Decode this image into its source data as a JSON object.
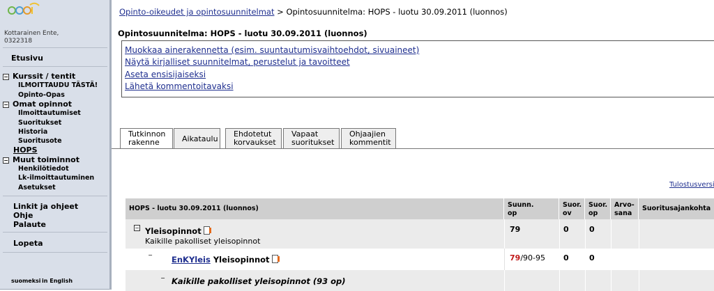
{
  "sidebar": {
    "user_name": "Kottarainen Ente,",
    "user_id": "0322318",
    "home": "Etusivu",
    "sections": [
      {
        "label": "Kurssit / tentit",
        "items": [
          "ILMOITTAUDU TÄSTÄ!",
          "Opinto-Opas"
        ]
      },
      {
        "label": "Omat opinnot",
        "items": [
          "Ilmoittautumiset",
          "Suoritukset",
          "Historia",
          "Suoritusote"
        ]
      },
      {
        "label": "Muut toiminnot",
        "items": [
          "Henkilötiedot",
          "Lk-ilmoittautuminen",
          "Asetukset"
        ]
      }
    ],
    "hops": "HOPS",
    "links": [
      "Linkit ja ohjeet",
      "Ohje",
      "Palaute"
    ],
    "logout": "Lopeta",
    "lang_fi": "suomeksi",
    "lang_en": "in English"
  },
  "breadcrumb": {
    "link": "Opinto-oikeudet ja opintosuunnitelmat",
    "separator": ">",
    "current": "Opintosuunnitelma: HOPS - luotu 30.09.2011 (luonnos)"
  },
  "page_title": "Opintosuunnitelma: HOPS - luotu 30.09.2011 (luonnos)",
  "actions": [
    "Muokkaa ainerakennetta (esim. suuntautumisvaihtoehdot, sivuaineet)",
    "Näytä kirjalliset suunnitelmat, perustelut ja tavoitteet",
    "Aseta ensisijaiseksi",
    "Lähetä kommentoitavaksi"
  ],
  "tabs": [
    {
      "line1": "Tutkinnon",
      "line2": "rakenne"
    },
    {
      "line1": "Aikataulu",
      "line2": ""
    },
    {
      "line1": "Ehdotetut",
      "line2": "korvaukset"
    },
    {
      "line1": "Vapaat",
      "line2": "suoritukset"
    },
    {
      "line1": "Ohjaajien",
      "line2": "kommentit"
    }
  ],
  "print_link": "Tulostusversi",
  "table": {
    "headers": {
      "name": "HOPS - luotu 30.09.2011 (luonnos)",
      "planned": [
        "Suunn.",
        "op"
      ],
      "done_ov": [
        "Suor.",
        "ov"
      ],
      "done_op": [
        "Suor.",
        "op"
      ],
      "grade": [
        "Arvo-",
        "sana"
      ],
      "date": "Suoritusajankohta"
    },
    "rows": [
      {
        "title": "Yleisopinnot",
        "subtitle": "Kaikille pakolliset yleisopinnot",
        "planned": "79",
        "ov": "0",
        "op": "0"
      },
      {
        "code": "EnKYleis",
        "title": "Yleisopinnot",
        "planned_red": "79",
        "planned_rest": "/90-95",
        "ov": "0",
        "op": "0"
      },
      {
        "title": "Kaikille pakolliset yleisopinnot (93 op)"
      }
    ]
  },
  "colors": {
    "link": "#1f2f8f",
    "sidebar_bg": "#d9dfe9",
    "header_bg": "#cfcfcf",
    "accent_red": "#c01818",
    "row_alt": "#ebebeb"
  }
}
